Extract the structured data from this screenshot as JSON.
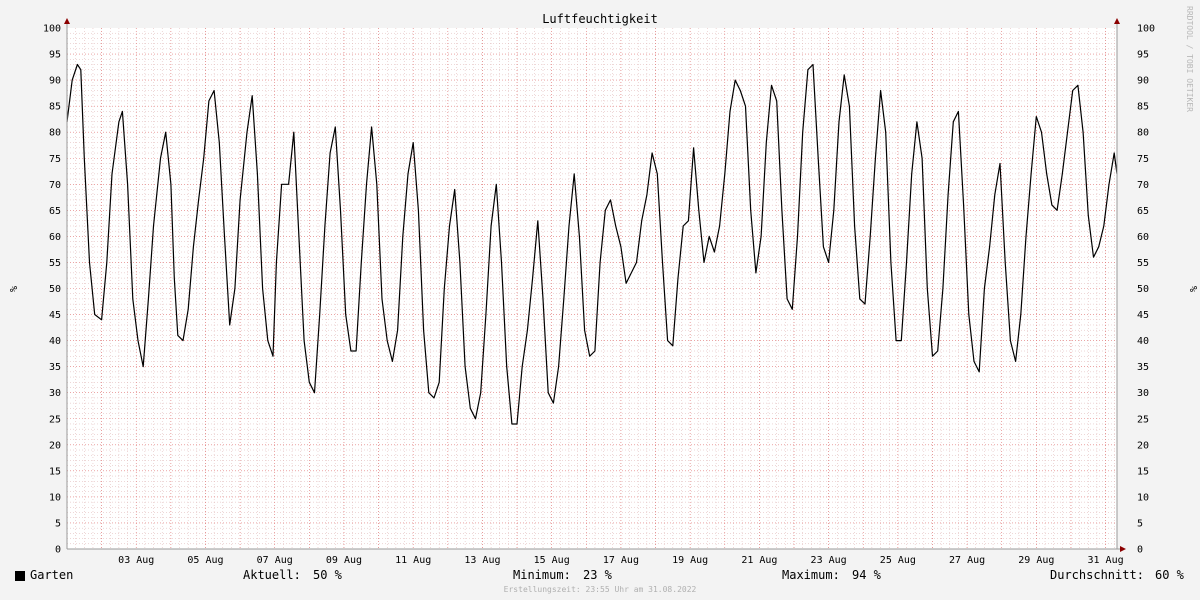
{
  "chart_data": {
    "type": "line",
    "title": "Luftfeuchtigkeit",
    "ylabel": "%",
    "ylim": [
      0,
      100
    ],
    "y_ticks": [
      "0",
      "5",
      "10",
      "15",
      "20",
      "25",
      "30",
      "35",
      "40",
      "45",
      "50",
      "55",
      "60",
      "65",
      "70",
      "75",
      "80",
      "85",
      "90",
      "95",
      "100"
    ],
    "x_tick_labels": [
      "03 Aug",
      "05 Aug",
      "07 Aug",
      "09 Aug",
      "11 Aug",
      "13 Aug",
      "15 Aug",
      "17 Aug",
      "19 Aug",
      "21 Aug",
      "23 Aug",
      "25 Aug",
      "27 Aug",
      "29 Aug",
      "31 Aug"
    ],
    "x_range_days": [
      0,
      30.33
    ],
    "grid": true,
    "series": [
      {
        "name": "Garten",
        "color": "#000000",
        "points": [
          [
            0.0,
            82
          ],
          [
            0.15,
            90
          ],
          [
            0.3,
            93
          ],
          [
            0.4,
            92
          ],
          [
            0.5,
            75
          ],
          [
            0.65,
            55
          ],
          [
            0.8,
            45
          ],
          [
            1.0,
            44
          ],
          [
            1.15,
            55
          ],
          [
            1.3,
            72
          ],
          [
            1.5,
            82
          ],
          [
            1.6,
            84
          ],
          [
            1.75,
            70
          ],
          [
            1.9,
            48
          ],
          [
            2.05,
            40
          ],
          [
            2.2,
            35
          ],
          [
            2.35,
            48
          ],
          [
            2.5,
            62
          ],
          [
            2.7,
            75
          ],
          [
            2.85,
            80
          ],
          [
            3.0,
            70
          ],
          [
            3.1,
            52
          ],
          [
            3.2,
            41
          ],
          [
            3.35,
            40
          ],
          [
            3.5,
            46
          ],
          [
            3.65,
            58
          ],
          [
            3.8,
            67
          ],
          [
            3.95,
            75
          ],
          [
            4.1,
            86
          ],
          [
            4.25,
            88
          ],
          [
            4.4,
            78
          ],
          [
            4.55,
            60
          ],
          [
            4.7,
            43
          ],
          [
            4.85,
            50
          ],
          [
            5.0,
            67
          ],
          [
            5.2,
            80
          ],
          [
            5.35,
            87
          ],
          [
            5.5,
            72
          ],
          [
            5.65,
            50
          ],
          [
            5.8,
            40
          ],
          [
            5.95,
            37
          ],
          [
            6.05,
            55
          ],
          [
            6.2,
            70
          ],
          [
            6.4,
            70
          ],
          [
            6.55,
            80
          ],
          [
            6.7,
            60
          ],
          [
            6.85,
            40
          ],
          [
            7.0,
            32
          ],
          [
            7.15,
            30
          ],
          [
            7.3,
            45
          ],
          [
            7.45,
            62
          ],
          [
            7.6,
            76
          ],
          [
            7.75,
            81
          ],
          [
            7.9,
            65
          ],
          [
            8.05,
            45
          ],
          [
            8.2,
            38
          ],
          [
            8.35,
            38
          ],
          [
            8.5,
            55
          ],
          [
            8.65,
            70
          ],
          [
            8.8,
            81
          ],
          [
            8.95,
            70
          ],
          [
            9.1,
            48
          ],
          [
            9.25,
            40
          ],
          [
            9.4,
            36
          ],
          [
            9.55,
            42
          ],
          [
            9.7,
            60
          ],
          [
            9.85,
            72
          ],
          [
            10.0,
            78
          ],
          [
            10.15,
            65
          ],
          [
            10.3,
            42
          ],
          [
            10.45,
            30
          ],
          [
            10.6,
            29
          ],
          [
            10.75,
            32
          ],
          [
            10.9,
            50
          ],
          [
            11.05,
            62
          ],
          [
            11.2,
            69
          ],
          [
            11.35,
            55
          ],
          [
            11.5,
            35
          ],
          [
            11.65,
            27
          ],
          [
            11.8,
            25
          ],
          [
            11.95,
            30
          ],
          [
            12.1,
            45
          ],
          [
            12.25,
            62
          ],
          [
            12.4,
            70
          ],
          [
            12.55,
            55
          ],
          [
            12.7,
            35
          ],
          [
            12.85,
            24
          ],
          [
            13.0,
            24
          ],
          [
            13.15,
            35
          ],
          [
            13.3,
            42
          ],
          [
            13.45,
            52
          ],
          [
            13.6,
            63
          ],
          [
            13.75,
            48
          ],
          [
            13.9,
            30
          ],
          [
            14.05,
            28
          ],
          [
            14.2,
            35
          ],
          [
            14.35,
            48
          ],
          [
            14.5,
            62
          ],
          [
            14.65,
            72
          ],
          [
            14.8,
            60
          ],
          [
            14.95,
            42
          ],
          [
            15.1,
            37
          ],
          [
            15.25,
            38
          ],
          [
            15.4,
            55
          ],
          [
            15.55,
            65
          ],
          [
            15.7,
            67
          ],
          [
            15.85,
            62
          ],
          [
            16.0,
            58
          ],
          [
            16.15,
            51
          ],
          [
            16.3,
            53
          ],
          [
            16.45,
            55
          ],
          [
            16.6,
            63
          ],
          [
            16.75,
            68
          ],
          [
            16.9,
            76
          ],
          [
            17.05,
            72
          ],
          [
            17.2,
            55
          ],
          [
            17.35,
            40
          ],
          [
            17.5,
            39
          ],
          [
            17.65,
            52
          ],
          [
            17.8,
            62
          ],
          [
            17.95,
            63
          ],
          [
            18.1,
            77
          ],
          [
            18.25,
            65
          ],
          [
            18.4,
            55
          ],
          [
            18.55,
            60
          ],
          [
            18.7,
            57
          ],
          [
            18.85,
            62
          ],
          [
            19.0,
            72
          ],
          [
            19.15,
            84
          ],
          [
            19.3,
            90
          ],
          [
            19.45,
            88
          ],
          [
            19.6,
            85
          ],
          [
            19.75,
            65
          ],
          [
            19.9,
            53
          ],
          [
            20.05,
            60
          ],
          [
            20.2,
            78
          ],
          [
            20.35,
            89
          ],
          [
            20.5,
            86
          ],
          [
            20.65,
            65
          ],
          [
            20.8,
            48
          ],
          [
            20.95,
            46
          ],
          [
            21.1,
            60
          ],
          [
            21.25,
            80
          ],
          [
            21.4,
            92
          ],
          [
            21.55,
            93
          ],
          [
            21.7,
            75
          ],
          [
            21.85,
            58
          ],
          [
            22.0,
            55
          ],
          [
            22.15,
            65
          ],
          [
            22.3,
            82
          ],
          [
            22.45,
            91
          ],
          [
            22.6,
            85
          ],
          [
            22.75,
            62
          ],
          [
            22.9,
            48
          ],
          [
            23.05,
            47
          ],
          [
            23.2,
            60
          ],
          [
            23.35,
            75
          ],
          [
            23.5,
            88
          ],
          [
            23.65,
            80
          ],
          [
            23.8,
            55
          ],
          [
            23.95,
            40
          ],
          [
            24.1,
            40
          ],
          [
            24.25,
            55
          ],
          [
            24.4,
            72
          ],
          [
            24.55,
            82
          ],
          [
            24.7,
            75
          ],
          [
            24.85,
            50
          ],
          [
            25.0,
            37
          ],
          [
            25.15,
            38
          ],
          [
            25.3,
            50
          ],
          [
            25.45,
            68
          ],
          [
            25.6,
            82
          ],
          [
            25.75,
            84
          ],
          [
            25.9,
            66
          ],
          [
            26.05,
            45
          ],
          [
            26.2,
            36
          ],
          [
            26.35,
            34
          ],
          [
            26.5,
            50
          ],
          [
            26.65,
            58
          ],
          [
            26.8,
            68
          ],
          [
            26.95,
            74
          ],
          [
            27.1,
            55
          ],
          [
            27.25,
            40
          ],
          [
            27.4,
            36
          ],
          [
            27.55,
            45
          ],
          [
            27.7,
            60
          ],
          [
            27.85,
            72
          ],
          [
            28.0,
            83
          ],
          [
            28.15,
            80
          ],
          [
            28.3,
            72
          ],
          [
            28.45,
            66
          ],
          [
            28.6,
            65
          ],
          [
            28.75,
            72
          ],
          [
            28.9,
            80
          ],
          [
            29.05,
            88
          ],
          [
            29.2,
            89
          ],
          [
            29.35,
            80
          ],
          [
            29.5,
            64
          ],
          [
            29.65,
            56
          ],
          [
            29.8,
            58
          ],
          [
            29.95,
            62
          ],
          [
            30.1,
            70
          ],
          [
            30.25,
            76
          ],
          [
            30.33,
            72
          ]
        ]
      }
    ]
  },
  "watermark": "RRDTOOL / TOBI OETIKER",
  "legend": {
    "series_label": "Garten",
    "current_label": "Aktuell:",
    "current_value": "50 %",
    "min_label": "Minimum:",
    "min_value": "23 %",
    "max_label": "Maximum:",
    "max_value": "94 %",
    "avg_label": "Durchschnitt:",
    "avg_value": "60 %"
  },
  "footer": "Erstellungszeit: 23:55 Uhr am 31.08.2022",
  "colors": {
    "background": "#f3f3f3",
    "plot_background": "#ffffff",
    "minor_grid": "#dcb0b0",
    "major_grid": "#e07070",
    "axis": "#999999",
    "arrow": "#8b0000",
    "line": "#000000"
  }
}
